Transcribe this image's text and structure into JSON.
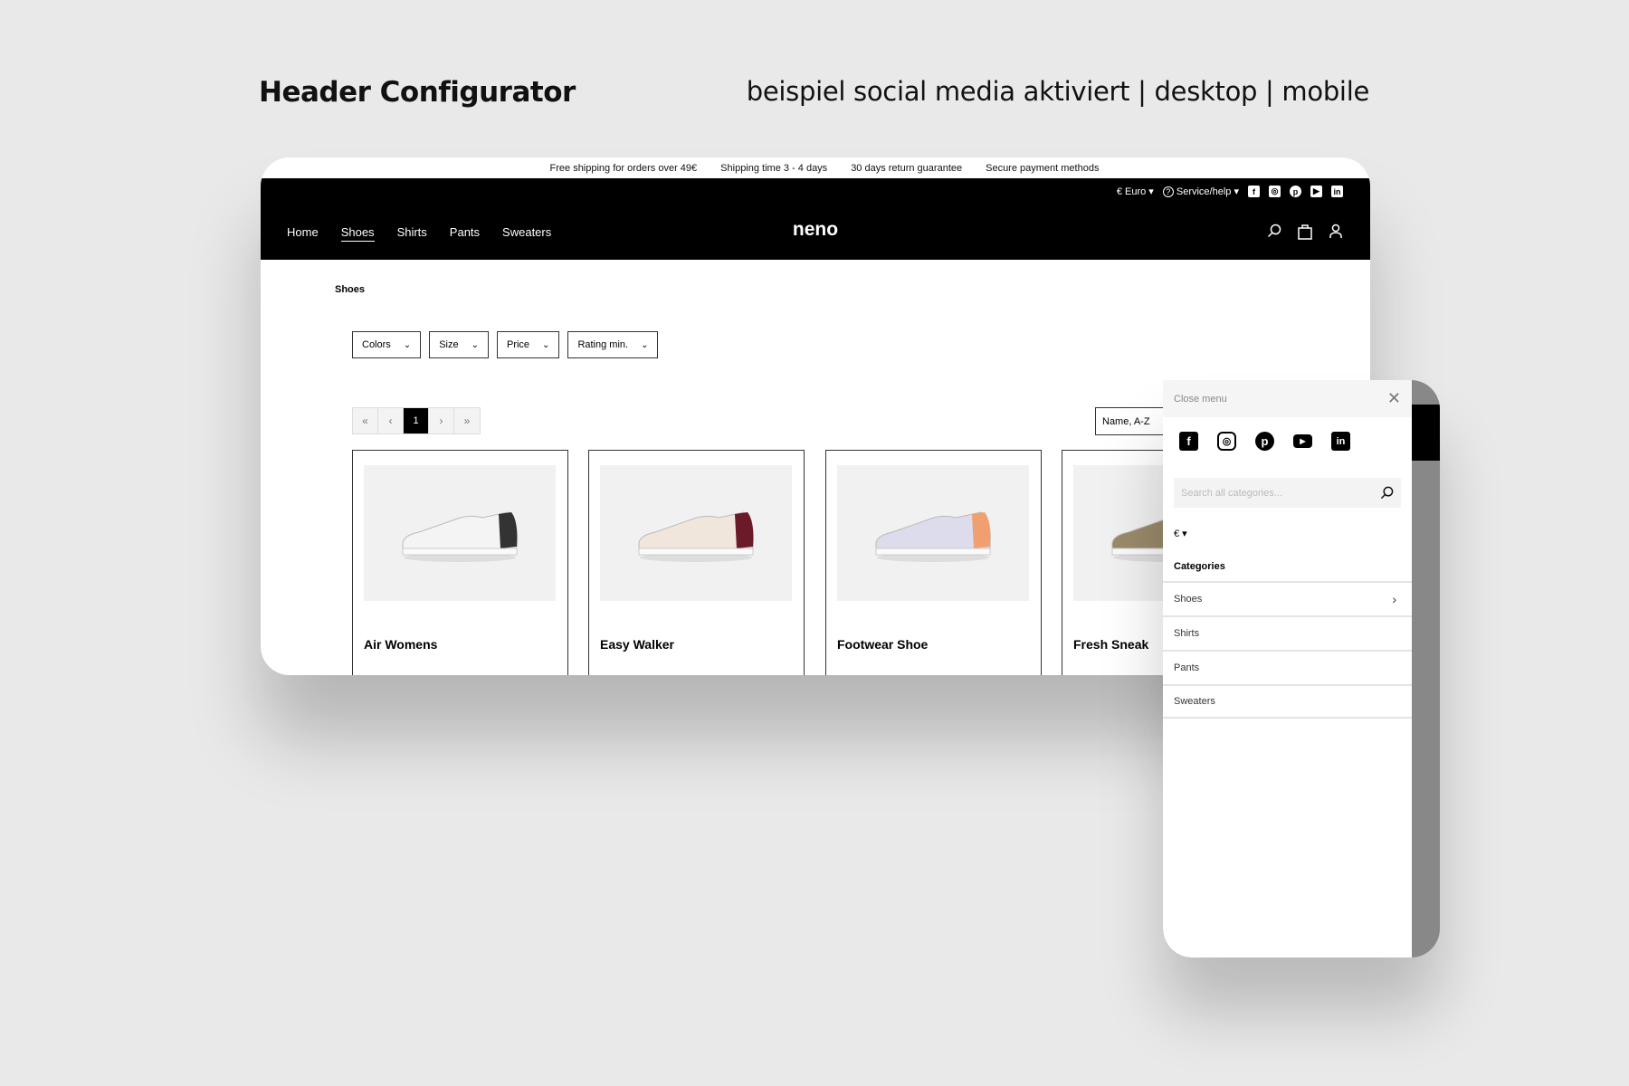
{
  "heading": {
    "title": "Header Configurator",
    "subtitle": "beispiel social media aktiviert | desktop | mobile"
  },
  "desktop": {
    "infobar": [
      "Free shipping for orders over 49€",
      "Shipping time 3 - 4 days",
      "30 days return guarantee",
      "Secure payment methods"
    ],
    "currency": "€ Euro",
    "service": "Service/help",
    "nav": [
      "Home",
      "Shoes",
      "Shirts",
      "Pants",
      "Sweaters"
    ],
    "active_nav": "Shoes",
    "logo": "neno",
    "breadcrumb": "Shoes",
    "filters": [
      "Colors",
      "Size",
      "Price",
      "Rating min."
    ],
    "pager": [
      "«",
      "‹",
      "1",
      "›",
      "»"
    ],
    "sort": "Name, A-Z",
    "products": [
      {
        "name": "Air Womens",
        "color": "#f4f4f4",
        "accent": "#333333"
      },
      {
        "name": "Easy Walker",
        "color": "#f0e6dc",
        "accent": "#6b1a2a"
      },
      {
        "name": "Footwear Shoe",
        "color": "#dcdcec",
        "accent": "#f0a070"
      },
      {
        "name": "Fresh Sneak",
        "color": "#9a8a6a",
        "accent": "#c89030"
      }
    ]
  },
  "mobile": {
    "close": "Close menu",
    "search_placeholder": "Search all categories...",
    "currency": "€",
    "categories_label": "Categories",
    "categories": [
      "Shoes",
      "Shirts",
      "Pants",
      "Sweaters"
    ]
  }
}
